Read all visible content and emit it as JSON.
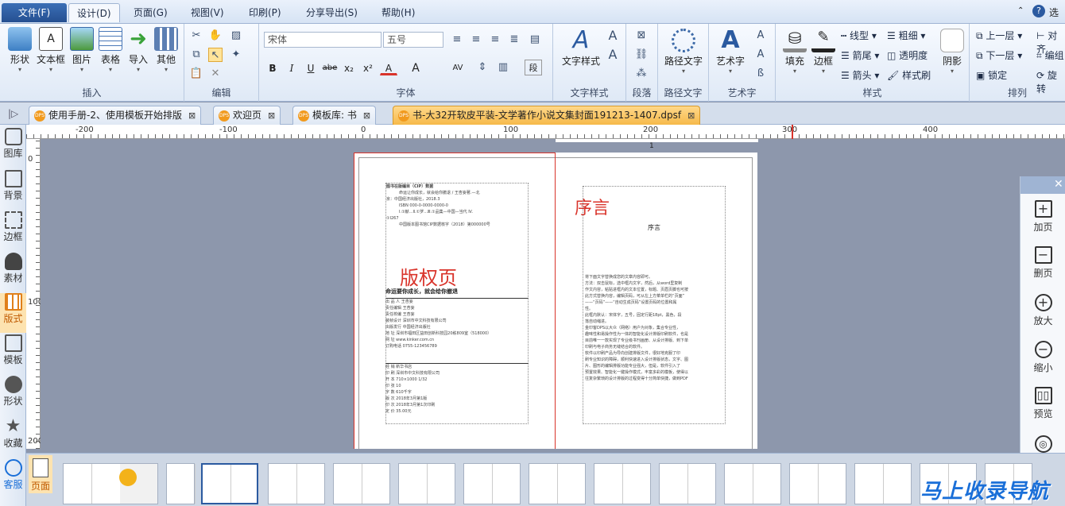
{
  "menu": {
    "file": "文件(F)",
    "design": "设计(D)",
    "page": "页面(G)",
    "view": "视图(V)",
    "print": "印刷(P)",
    "share": "分享导出(S)",
    "help": "帮助(H)",
    "right": "选"
  },
  "ribbon": {
    "insert": {
      "label": "插入",
      "shape": "形状",
      "textbox": "文本框",
      "image": "图片",
      "table": "表格",
      "import": "导入",
      "other": "其他"
    },
    "edit": {
      "label": "编辑"
    },
    "font": {
      "label": "字体",
      "family": "宋体",
      "size": "五号",
      "bold": "B",
      "italic": "I",
      "underline": "U",
      "strike": "abe",
      "sub": "x₂",
      "sup": "x²",
      "color": "A",
      "size_a": "A",
      "spacing": "AV",
      "scale": "段"
    },
    "textstyle": {
      "label": "文字样式",
      "btn": "文字样式"
    },
    "para": {
      "label": "段落"
    },
    "path": {
      "label": "路径文字",
      "btn": "路径文字"
    },
    "art": {
      "label": "艺术字",
      "btn": "艺术字"
    },
    "style": {
      "label": "样式",
      "fill": "填充",
      "border": "边框",
      "linetype": "线型",
      "linewidth": "粗细",
      "arrowtail": "箭尾",
      "transparency": "透明度",
      "arrowhead": "箭头",
      "stylebrush": "样式刷",
      "shadow": "阴影"
    },
    "arrange": {
      "label": "排列",
      "up": "上一层",
      "down": "下一层",
      "lock": "锁定",
      "align": "对齐",
      "group": "编组",
      "rotate": "旋转"
    }
  },
  "tabs": [
    {
      "label": "使用手册-2、使用模板开始排版"
    },
    {
      "label": "欢迎页"
    },
    {
      "label": "模板库: 书"
    },
    {
      "label": "书-大32开软皮平装-文学著作小说文集封面191213-1407.dpsf"
    }
  ],
  "leftbar": [
    "图库",
    "背景",
    "边框",
    "素材",
    "版式",
    "模板",
    "形状",
    "收藏",
    "客服"
  ],
  "ruler": {
    "h": [
      "-200",
      "-100",
      "0",
      "100",
      "200",
      "300",
      "400"
    ],
    "v": [
      "0",
      "100",
      "200"
    ],
    "page_no": "1"
  },
  "pages": {
    "left_title": "版权页",
    "right_title": "序言",
    "right_heading": "序言",
    "cip_title": "图书在版编目（CIP）数据",
    "cip_lines": [
      "命运让你成长，就会给你撤退 / 王杏妄著.—北",
      "京：中国经济出版社，2018.3",
      "ISBN 000-0-0000-0000-0",
      "I.①献…Ⅱ.①罗…Ⅲ.①品集—中国—当代 Ⅳ.",
      "①I267",
      "中国版本图书馆CIP数据核字（2018）第000000号"
    ],
    "book_title": "命运要你成长，就会给你撤退",
    "info1": [
      "出 品 人  王杏妄",
      "责任编辑  王杏妄",
      "责任校编  王杏妄",
      "装帧设计  深圳市中文科技有限公司",
      "出版发行  中国经济出版社",
      "地    址  深圳市福田区益田创新科技园20栋809室（518000）",
      "网    址  www.kinker.com.cn",
      "订购电话  0755-123456789"
    ],
    "info2": [
      "经    销  新华书店",
      "印    刷  深圳市中文科技有限公司",
      "开    本  710×1000   1/32",
      "印    张  10",
      "字    数  610千字",
      "版    次  2018年3月第1版",
      "印    次  2018年3月第1次印刷",
      "定    价  35.00元"
    ],
    "preface": [
      "将下面文字替换成您的文章内容即可。",
      "方法：双击鼠标，选中框内文字，然后，从word里复制",
      "作文内容，粘贴进框内的文本位置，标题、页眉页脚也可按",
      "此方式替换内容，编辑页码，可从左上方菜单栏的“页面”",
      "——“页码”——“自动生成页码”设置页码的位置和属",
      "性。",
      "此框内默认：宋体字，五号，固定行距18pt，黑色，段",
      "落自动缩进。",
      "金印客DPS以大众（网络）用户为对象，集合专业性，",
      "趣味性和易操作性为一体的智能化设计排版印刷软件，也是",
      "目前唯一一款实现了专业级书刊画册、从设计排版、到下单",
      "印刷与电子商务无缝结合的软件。",
      "软件以印刷产品为导向创建排版文件，很好地克服了印",
      "刷专业知识的障碍，顺利快速进入设计排版状态，文字、图",
      "片、图形的编辑排版功能专业强大，但是，软件引入了",
      "预置效果、智能化一键操作模式，丰富多彩的模板，使得以",
      "往复杂繁琐的设计排版的过程变得十分简单快捷，做到PDF"
    ]
  },
  "rightpanel": {
    "add": "加页",
    "delete": "删页",
    "zoomin": "放大",
    "zoomout": "缩小",
    "preview": "预览",
    "share": "分享"
  },
  "thumbbar": {
    "page_label": "页面"
  },
  "watermark": "马上收录导航",
  "colors": {
    "accent": "#2b5aa0",
    "red": "#d9342b",
    "tab_active": "#f6b94a",
    "orange_icon": "#f19a1e"
  }
}
